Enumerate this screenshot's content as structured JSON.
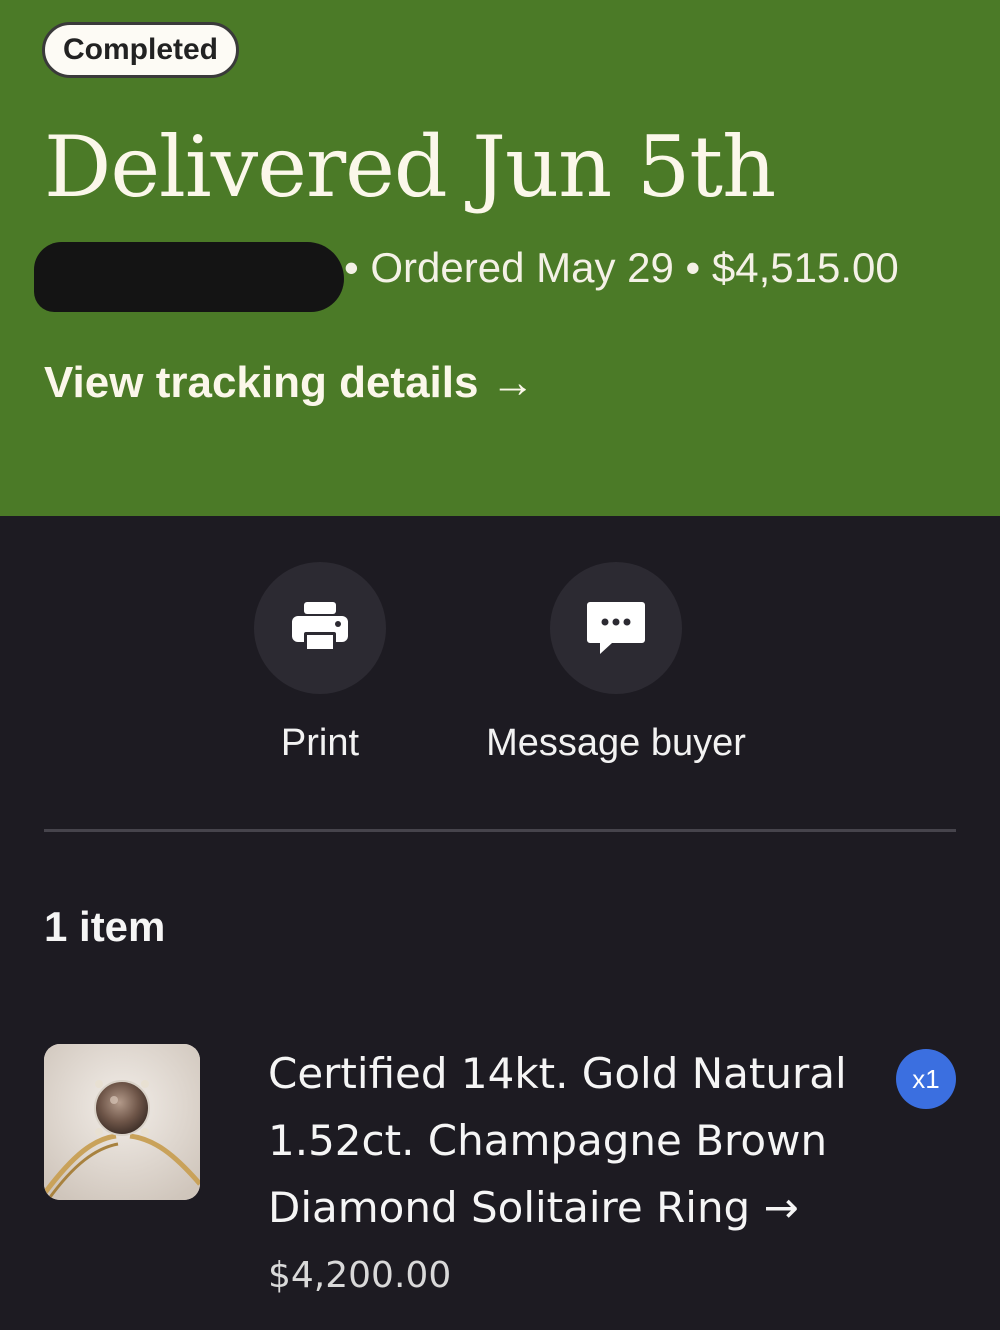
{
  "header": {
    "status_badge": "Completed",
    "title": "Delivered Jun 5th",
    "order_meta": "• Ordered May 29 • $4,515.00",
    "tracking_link": "View tracking details →"
  },
  "actions": {
    "print_label": "Print",
    "message_label": "Message buyer"
  },
  "items_section": {
    "count_label": "1 item",
    "items": [
      {
        "title": "Certified 14kt. Gold Natural 1.52ct. Champagne Brown Diamond Solitaire Ring →",
        "price": "$4,200.00",
        "quantity": "x1"
      }
    ]
  },
  "colors": {
    "header_bg": "#4b7a27",
    "page_bg": "#1d1b22",
    "quantity_badge": "#3b6fe0"
  },
  "icons": [
    "printer-icon",
    "chat-bubble-icon"
  ]
}
